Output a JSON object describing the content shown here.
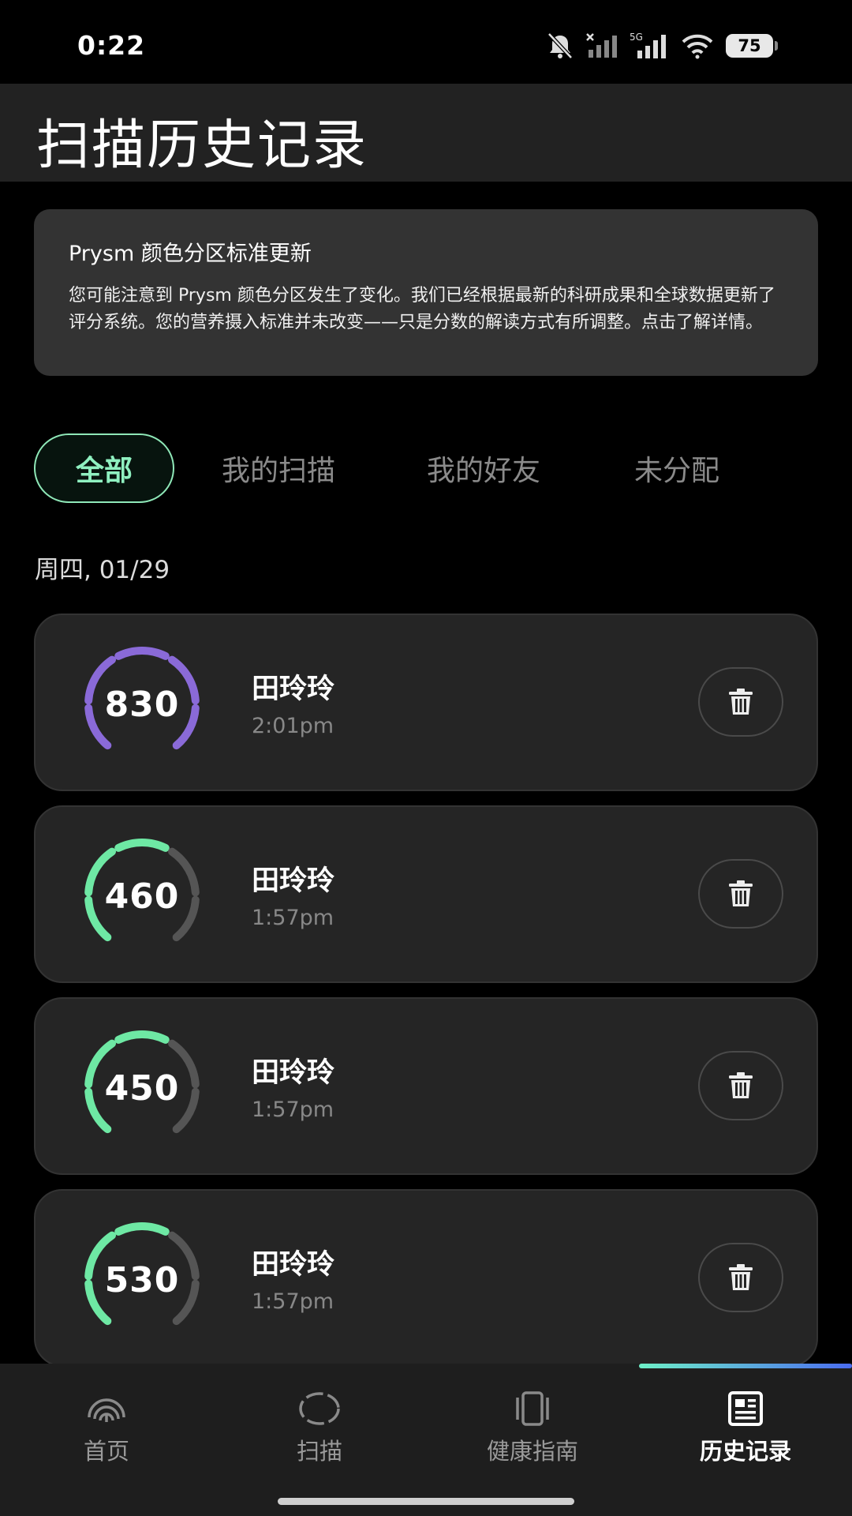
{
  "status_bar": {
    "time": "0:22",
    "network": "5G",
    "battery": "75",
    "icons": [
      "bell-muted-icon",
      "signal-off-icon",
      "signal-5g-icon",
      "wifi-icon",
      "battery-icon"
    ]
  },
  "header": {
    "title": "扫描历史记录"
  },
  "notice": {
    "title": "Prysm 颜色分区标准更新",
    "body": "您可能注意到 Prysm 颜色分区发生了变化。我们已经根据最新的科研成果和全球数据更新了评分系统。您的营养摄入标准并未改变——只是分数的解读方式有所调整。点击了解详情。"
  },
  "filter_tabs": [
    {
      "label": "全部",
      "active": true
    },
    {
      "label": "我的扫描",
      "active": false
    },
    {
      "label": "我的好友",
      "active": false
    },
    {
      "label": "未分配",
      "active": false
    }
  ],
  "date_label": "周四, 01/29",
  "scans": [
    {
      "score": "830",
      "name": "田玲玲",
      "time": "2:01pm",
      "ring_color": "#8a6ad8",
      "ring_fill": 1.0
    },
    {
      "score": "460",
      "name": "田玲玲",
      "time": "1:57pm",
      "ring_color": "#6ee8a4",
      "ring_fill": 0.6
    },
    {
      "score": "450",
      "name": "田玲玲",
      "time": "1:57pm",
      "ring_color": "#6ee8a4",
      "ring_fill": 0.6
    },
    {
      "score": "530",
      "name": "田玲玲",
      "time": "1:57pm",
      "ring_color": "#6ee8a4",
      "ring_fill": 0.6
    }
  ],
  "ring_track_color": "#555555",
  "bottom_nav": [
    {
      "label": "首页",
      "icon": "fingerprint-icon",
      "active": false
    },
    {
      "label": "扫描",
      "icon": "scan-ring-icon",
      "active": false
    },
    {
      "label": "健康指南",
      "icon": "guide-icon",
      "active": false
    },
    {
      "label": "历史记录",
      "icon": "history-icon",
      "active": true
    }
  ]
}
